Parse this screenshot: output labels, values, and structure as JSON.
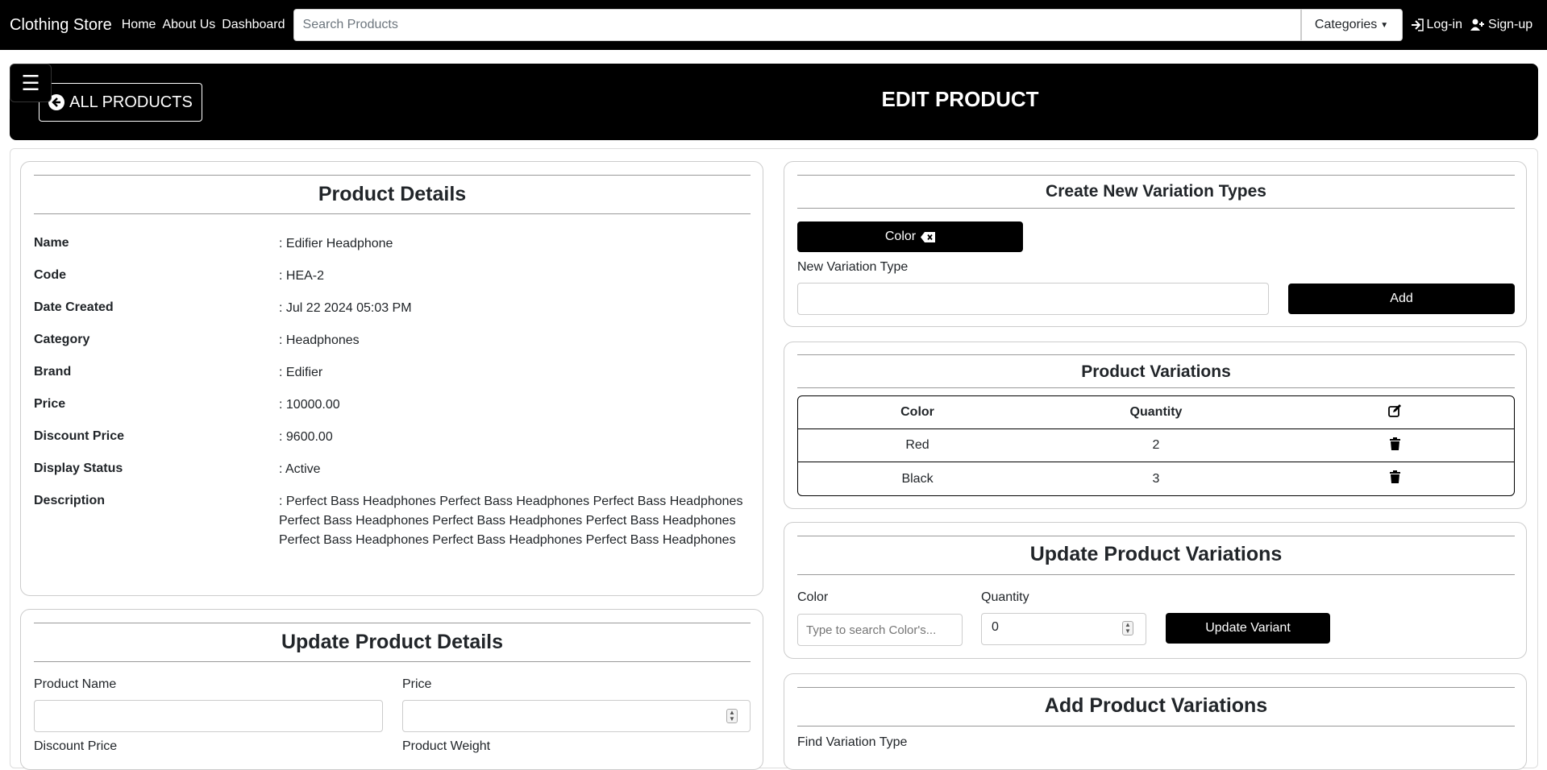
{
  "nav": {
    "brand": "Clothing Store",
    "links": [
      "Home",
      "About Us",
      "Dashboard"
    ],
    "search_placeholder": "Search Products",
    "categories_label": "Categories",
    "login_label": "Log-in",
    "signup_label": "Sign-up"
  },
  "header": {
    "back_label": "ALL PRODUCTS",
    "title": "EDIT PRODUCT",
    "menu_icon": "hamburger-icon"
  },
  "product_details": {
    "title": "Product Details",
    "rows": [
      {
        "label": "Name",
        "value": ": Edifier Headphone"
      },
      {
        "label": "Code",
        "value": ": HEA-2"
      },
      {
        "label": "Date Created",
        "value": ": Jul 22 2024 05:03 PM"
      },
      {
        "label": "Category",
        "value": ": Headphones"
      },
      {
        "label": "Brand",
        "value": ": Edifier"
      },
      {
        "label": "Price",
        "value": ": 10000.00"
      },
      {
        "label": "Discount Price",
        "value": ": 9600.00"
      },
      {
        "label": "Display Status",
        "value": ": Active"
      },
      {
        "label": "Description",
        "value": ": Perfect Bass Headphones Perfect Bass Headphones Perfect Bass Headphones Perfect Bass Headphones Perfect Bass Headphones Perfect Bass Headphones Perfect Bass Headphones Perfect Bass Headphones Perfect Bass Headphones"
      }
    ]
  },
  "update_details": {
    "title": "Update Product Details",
    "product_name_label": "Product Name",
    "price_label": "Price",
    "discount_price_label": "Discount Price",
    "weight_label": "Product Weight"
  },
  "variation_types": {
    "title": "Create New Variation Types",
    "chip_label": "Color",
    "new_type_label": "New Variation Type",
    "add_label": "Add"
  },
  "product_variations": {
    "title": "Product Variations",
    "columns": [
      "Color",
      "Quantity"
    ],
    "rows": [
      {
        "color": "Red",
        "quantity": "2"
      },
      {
        "color": "Black",
        "quantity": "3"
      }
    ]
  },
  "update_variations": {
    "title": "Update Product Variations",
    "color_label": "Color",
    "color_placeholder": "Type to search Color's...",
    "quantity_label": "Quantity",
    "quantity_value": "0",
    "button_label": "Update Variant"
  },
  "add_variations": {
    "title": "Add Product Variations",
    "find_label": "Find Variation Type"
  }
}
